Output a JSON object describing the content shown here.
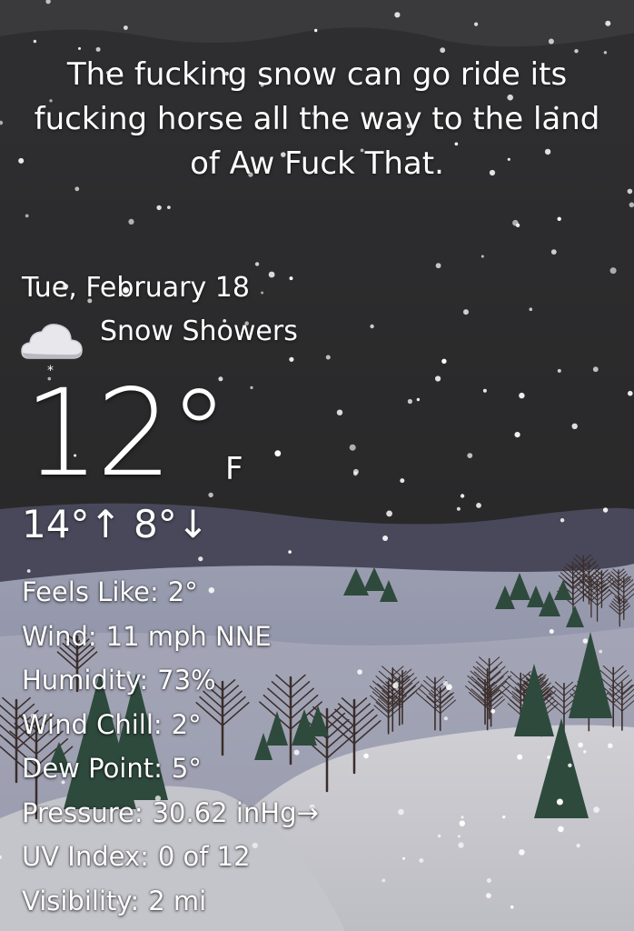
{
  "headline": "The fucking snow can go ride its fucking horse all the way to the land of Aw Fuck That.",
  "date": "Tue, February 18",
  "condition": {
    "icon": "snow-cloud-icon",
    "text": "Snow Showers"
  },
  "temperature": {
    "value": "12°",
    "unit": "F",
    "high": "14°",
    "high_arrow": "↑",
    "low": "8°",
    "low_arrow": "↓"
  },
  "details": [
    {
      "label": "Feels Like:",
      "value": "2°"
    },
    {
      "label": "Wind:",
      "value": "11 mph NNE"
    },
    {
      "label": "Humidity:",
      "value": "73%"
    },
    {
      "label": "Wind Chill:",
      "value": "2°"
    },
    {
      "label": "Dew Point:",
      "value": "5°"
    },
    {
      "label": "Pressure:",
      "value": "30.62 inHg→"
    },
    {
      "label": "UV Index:",
      "value": "0 of 12"
    },
    {
      "label": "Visibility:",
      "value": "2 mi"
    }
  ],
  "colors": {
    "sky": "#2b2b2d",
    "far_hill": "#4c4c58",
    "mid_field": "#8f93a8",
    "snow": "#c9c9cf",
    "tree_green": "#2e4a3c",
    "bare_tree": "#3a2d2a"
  }
}
